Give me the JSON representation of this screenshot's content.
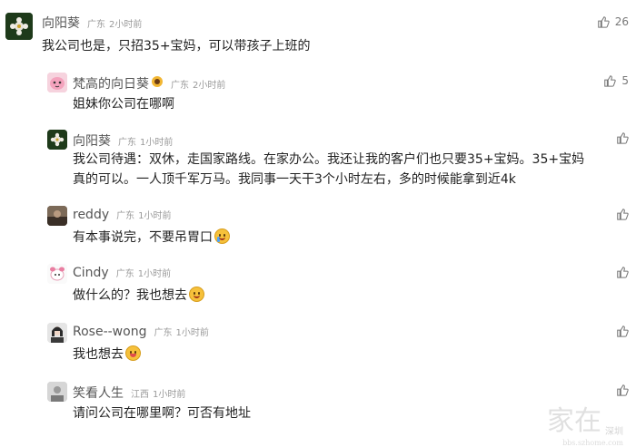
{
  "comments": [
    {
      "name": "向阳葵",
      "location": "广东",
      "time": "2小时前",
      "text": "我公司也是，只招35+宝妈，可以带孩子上班的",
      "likes": "26"
    },
    {
      "name": "梵高的向日葵",
      "location": "广东",
      "time": "2小时前",
      "text": "姐妹你公司在哪啊",
      "likes": "5"
    },
    {
      "name": "向阳葵",
      "location": "广东",
      "time": "1小时前",
      "text_line1": "我公司待遇：双休，走国家路线。在家办公。我还让我的客户们也只要35+宝妈。35+宝妈",
      "text_line2": "真的可以。一人顶千军万马。我同事一天干3个小时左右，多的时候能拿到近4k"
    },
    {
      "name": "reddy",
      "location": "广东",
      "time": "1小时前",
      "text": "有本事说完，不要吊胃口"
    },
    {
      "name": "Cindy",
      "location": "广东",
      "time": "1小时前",
      "text": "做什么的？我也想去"
    },
    {
      "name": "Rose--wong",
      "location": "广东",
      "time": "1小时前",
      "text": "我也想去"
    },
    {
      "name": "笑看人生",
      "location": "江西",
      "time": "1小时前",
      "text": "请问公司在哪里啊？可否有地址"
    }
  ],
  "watermark": {
    "main": "家在",
    "side": "深圳",
    "url": "bbs.szhome.com"
  },
  "icons": {
    "like": "thumbs-up-icon",
    "emoji_sun": "sunflower-emoji-icon"
  },
  "colors": {
    "text": "#222222",
    "meta": "#999999",
    "name": "#555555"
  }
}
